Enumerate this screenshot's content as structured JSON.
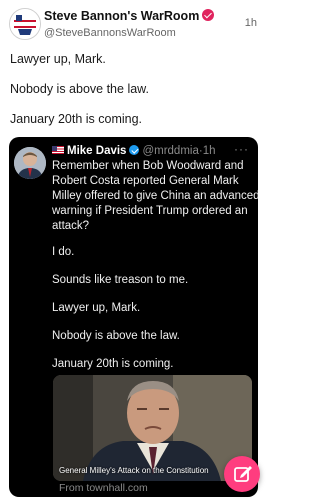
{
  "post": {
    "author_name": "Steve Bannon's WarRoom",
    "author_handle": "@SteveBannonsWarRoom",
    "timestamp": "1h",
    "lines": [
      "Lawyer up, Mark.",
      "Nobody is above the law.",
      "January 20th is coming."
    ]
  },
  "embed": {
    "author_name": "Mike Davis",
    "author_handle": "@mrddmia",
    "timestamp": "·1h",
    "more": "···",
    "text_lines": [
      "Remember when Bob Woodward and",
      "Robert Costa reported General Mark",
      "Milley offered to give China an advanced",
      "warning if President Trump ordered an",
      "attack?",
      "I do.",
      "Sounds like treason to me.",
      "Lawyer up, Mark.",
      "Nobody is above the law.",
      "January 20th is coming."
    ],
    "image_caption": "General Milley's Attack on the Constitution",
    "source": "From townhall.com"
  },
  "icons": {
    "verified_pink": "verified-badge-icon",
    "verified_blue": "verified-badge-icon",
    "flag": "us-flag-icon",
    "compose": "compose-pencil-icon"
  },
  "colors": {
    "accent_pink": "#ff3d7f",
    "embed_bg": "#000000",
    "verified_blue": "#1d9bf0"
  }
}
